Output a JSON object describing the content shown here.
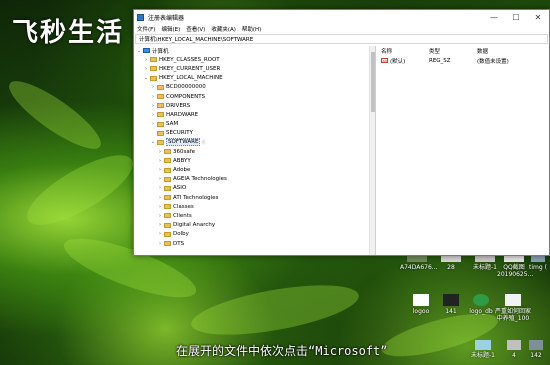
{
  "watermark": "飞秒生活",
  "subtitle": {
    "before": "在展开的文件中依次点击",
    "quoted": "“Microsoft”"
  },
  "window": {
    "title": "注册表编辑器",
    "controls": {
      "minimize": "—",
      "maximize": "☐",
      "close": "✕"
    },
    "menu": [
      "文件(F)",
      "编辑(E)",
      "查看(V)",
      "收藏夹(A)",
      "帮助(H)"
    ],
    "address": "计算机\\HKEY_LOCAL_MACHINE\\SOFTWARE"
  },
  "tree": [
    {
      "label": "计算机",
      "expanded": true,
      "icon": "computer-icon"
    },
    {
      "label": "HKEY_CLASSES_ROOT",
      "expanded": false,
      "icon": "folder-icon"
    },
    {
      "label": "HKEY_CURRENT_USER",
      "expanded": false,
      "icon": "folder-icon"
    },
    {
      "label": "HKEY_LOCAL_MACHINE",
      "expanded": true,
      "icon": "folder-icon"
    },
    {
      "label": "BCD00000000",
      "expanded": false,
      "icon": "folder-icon"
    },
    {
      "label": "COMPONENTS",
      "expanded": false,
      "icon": "folder-icon"
    },
    {
      "label": "DRIVERS",
      "expanded": false,
      "icon": "folder-icon"
    },
    {
      "label": "HARDWARE",
      "expanded": false,
      "icon": "folder-icon"
    },
    {
      "label": "SAM",
      "expanded": false,
      "icon": "folder-icon"
    },
    {
      "label": "SECURITY",
      "expanded": false,
      "icon": "folder-icon"
    },
    {
      "label": "SOFTWARE",
      "expanded": true,
      "selected": true,
      "icon": "folder-icon"
    },
    {
      "label": "360safe",
      "expanded": false,
      "icon": "folder-icon"
    },
    {
      "label": "ABBYY",
      "expanded": false,
      "icon": "folder-icon"
    },
    {
      "label": "Adobe",
      "expanded": false,
      "icon": "folder-icon"
    },
    {
      "label": "AGEIA Technologies",
      "expanded": false,
      "icon": "folder-icon"
    },
    {
      "label": "ASIO",
      "expanded": false,
      "icon": "folder-icon"
    },
    {
      "label": "ATI Technologies",
      "expanded": false,
      "icon": "folder-icon"
    },
    {
      "label": "Classes",
      "expanded": false,
      "icon": "folder-icon"
    },
    {
      "label": "Clients",
      "expanded": false,
      "icon": "folder-icon"
    },
    {
      "label": "Digital Anarchy",
      "expanded": false,
      "icon": "folder-icon"
    },
    {
      "label": "Dolby",
      "expanded": false,
      "icon": "folder-icon"
    },
    {
      "label": "DTS",
      "expanded": false,
      "icon": "folder-icon"
    }
  ],
  "values": {
    "headers": [
      "名称",
      "类型",
      "数据"
    ],
    "rows": [
      {
        "name": "(默认)",
        "type": "REG_SZ",
        "data": "(数值未设置)",
        "icon": "string-value-icon"
      }
    ]
  },
  "desktop": {
    "icons": [
      {
        "label": "A74DA676...",
        "name": "desktop-icon-a74da676"
      },
      {
        "label": "28",
        "name": "desktop-icon-28"
      },
      {
        "label": "未标题-1",
        "name": "desktop-icon-untitled-1"
      },
      {
        "label": "QQ截图 20190625...",
        "name": "desktop-icon-qq-screenshot"
      },
      {
        "label": "timg (",
        "name": "desktop-icon-timg"
      },
      {
        "label": "logoo",
        "name": "desktop-icon-logoo"
      },
      {
        "label": "141",
        "name": "desktop-icon-141"
      },
      {
        "label": "logo_db",
        "name": "desktop-icon-logo-db"
      },
      {
        "label": "严重如何回家中养殖_100",
        "name": "desktop-icon-article-100"
      },
      {
        "label": "4",
        "name": "desktop-icon-4"
      },
      {
        "label": "142",
        "name": "desktop-icon-142"
      }
    ],
    "topright_labels": [
      "ly",
      "2",
      "8",
      "w",
      "ty"
    ],
    "bottom_labels": [
      "未标题-1"
    ]
  }
}
